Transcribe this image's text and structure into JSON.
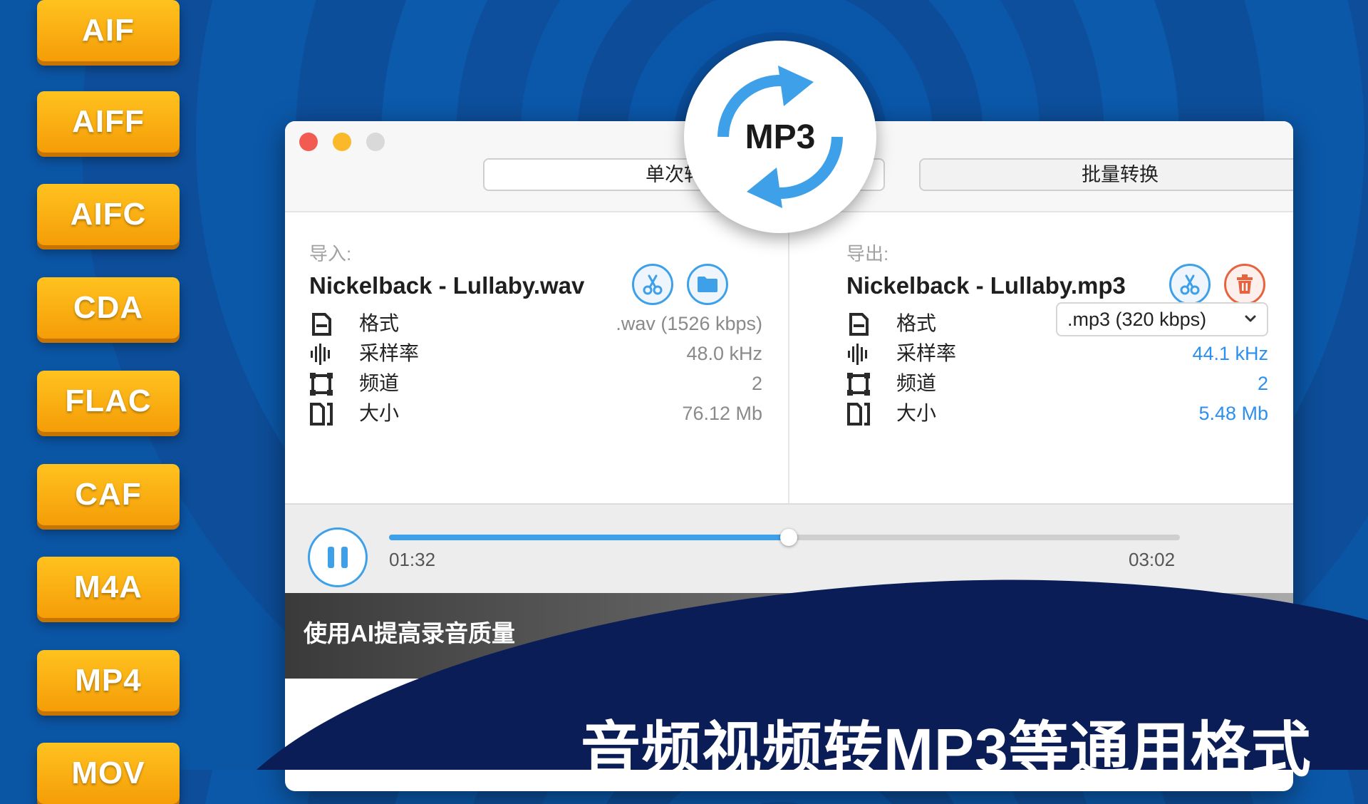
{
  "formats": [
    "AIF",
    "AIFF",
    "AIFC",
    "CDA",
    "FLAC",
    "CAF",
    "M4A",
    "MP4",
    "MOV"
  ],
  "logo": {
    "text": "MP3"
  },
  "tabs": {
    "single": "单次转换",
    "batch": "批量转换"
  },
  "input": {
    "heading": "导入:",
    "filename": "Nickelback - Lullaby.wav",
    "rows": [
      {
        "label": "格式",
        "value": ".wav (1526 kbps)"
      },
      {
        "label": "采样率",
        "value": "48.0 kHz"
      },
      {
        "label": "频道",
        "value": "2"
      },
      {
        "label": "大小",
        "value": "76.12 Mb"
      }
    ]
  },
  "output": {
    "heading": "导出:",
    "filename": "Nickelback - Lullaby.mp3",
    "rows": [
      {
        "label": "格式",
        "value": ".mp3 (320 kbps)"
      },
      {
        "label": "采样率",
        "value": "44.1 kHz"
      },
      {
        "label": "频道",
        "value": "2"
      },
      {
        "label": "大小",
        "value": "5.48 Mb"
      }
    ]
  },
  "player": {
    "current": "01:32",
    "total": "03:02",
    "progress": 0.505
  },
  "banner": {
    "text": "使用AI提高录音质量"
  },
  "bottom_title": "音频视频转MP3等通用格式",
  "colors": {
    "accent": "#3da0e8",
    "badge": "#f7a90e",
    "background": "#0b55a5",
    "delete": "#e8623d"
  }
}
